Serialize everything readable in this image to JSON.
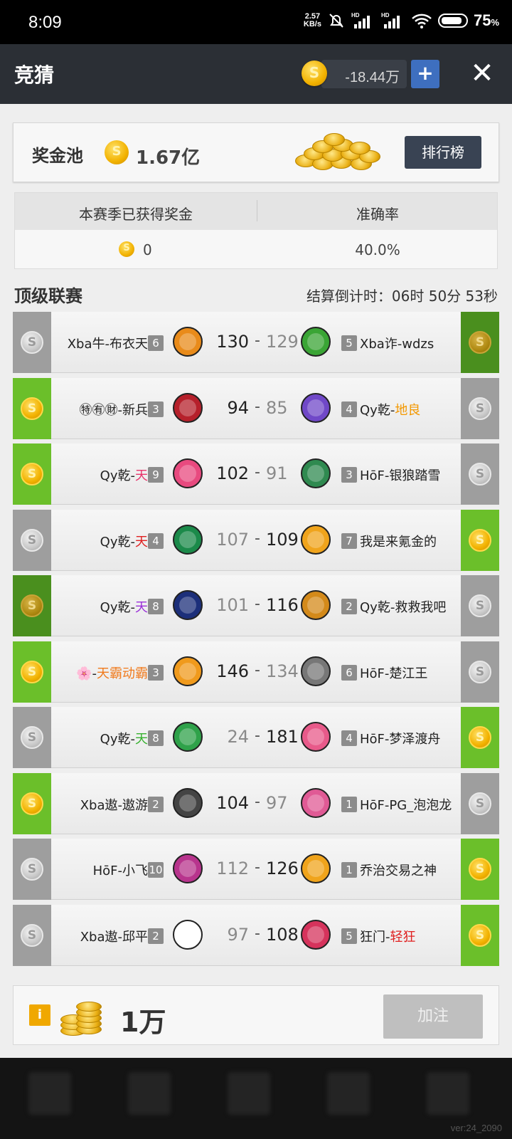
{
  "status_bar": {
    "time": "8:09",
    "net_speed_value": "2.57",
    "net_speed_unit": "KB/s",
    "battery": "75",
    "battery_unit": "%"
  },
  "header": {
    "title": "竞猜",
    "balance": "-18.44万",
    "add_label": "+",
    "close_label": "✕"
  },
  "jackpot": {
    "label": "奖金池",
    "amount": "1.67亿",
    "ranking_button": "排行榜"
  },
  "stats": {
    "earned_label": "本赛季已获得奖金",
    "accuracy_label": "准确率",
    "earned_value": "0",
    "accuracy_value": "40.0%"
  },
  "league": {
    "title": "顶级联赛",
    "countdown": "结算倒计时：06时 50分 53秒"
  },
  "matches": [
    {
      "left_name": "Xba牛-布衣天子",
      "left_suffix": "",
      "left_level": "6",
      "left_score": "130",
      "right_score": "129",
      "right_name": "Xba诈-wdzs",
      "right_suffix": "",
      "right_level": "5",
      "pick": "right",
      "win_side": "left"
    },
    {
      "left_name": "㊕㊒㊖-新兵器",
      "left_suffix": "",
      "left_level": "3",
      "left_score": "94",
      "right_score": "85",
      "right_name": "Qy乾-",
      "right_suffix": "地良",
      "right_level": "4",
      "pick": "left",
      "win_side": "left"
    },
    {
      "left_name": "Qy乾-",
      "left_suffix": "天损",
      "left_level": "9",
      "left_score": "102",
      "right_score": "91",
      "right_name": "HōF-银狼踏雪",
      "right_suffix": "",
      "right_level": "3",
      "pick": "left",
      "win_side": "left"
    },
    {
      "left_name": "Qy乾-",
      "left_suffix": "天逗",
      "left_level": "4",
      "left_score": "107",
      "right_score": "109",
      "right_name": "我是来氪金的",
      "right_suffix": "",
      "right_level": "7",
      "pick": "right",
      "win_side": "right"
    },
    {
      "left_name": "Qy乾-",
      "left_suffix": "天魁",
      "left_level": "8",
      "left_score": "101",
      "right_score": "116",
      "right_name": "Qy乾-救救我吧",
      "right_suffix": "",
      "right_level": "2",
      "pick": "left",
      "win_side": "right"
    },
    {
      "left_name": "🌸-",
      "left_suffix": "天霸动霸哒",
      "left_level": "3",
      "left_score": "146",
      "right_score": "134",
      "right_name": "HōF-楚江王",
      "right_suffix": "",
      "right_level": "6",
      "pick": "left",
      "win_side": "left"
    },
    {
      "left_name": "Qy乾-",
      "left_suffix": "天熊",
      "left_level": "8",
      "left_score": "24",
      "right_score": "181",
      "right_name": "HōF-梦泽渡舟",
      "right_suffix": "",
      "right_level": "4",
      "pick": "right",
      "win_side": "right"
    },
    {
      "left_name": "Xba遨-遨游武",
      "left_suffix": "",
      "left_level": "2",
      "left_score": "104",
      "right_score": "97",
      "right_name": "HōF-PG_泡泡龙",
      "right_suffix": "",
      "right_level": "1",
      "pick": "left",
      "win_side": "left"
    },
    {
      "left_name": "HōF-小飞侠",
      "left_suffix": "",
      "left_level": "10",
      "left_score": "112",
      "right_score": "126",
      "right_name": "乔治交易之神",
      "right_suffix": "",
      "right_level": "1",
      "pick": "right",
      "win_side": "right"
    },
    {
      "left_name": "Xba遨-邱平安",
      "left_suffix": "",
      "left_level": "2",
      "left_score": "97",
      "right_score": "108",
      "right_name": "狂门-",
      "right_suffix": "轻狂",
      "right_level": "5",
      "pick": "right",
      "win_side": "right"
    }
  ],
  "bet": {
    "info_label": "i",
    "amount": "1万",
    "button": "加注"
  },
  "footer": {
    "version": "ver:24_2090"
  },
  "colors": {
    "suffix_colors": [
      "",
      "#f39800",
      "#e8336b",
      "#e02020",
      "#9b30d9",
      "#f07a1c",
      "#36b12e",
      "",
      "",
      "#e02020"
    ],
    "logo_colors": [
      [
        "#e98b1a",
        "#3aa535"
      ],
      [
        "#b6202b",
        "#7048c8"
      ],
      [
        "#e84a7f",
        "#2f8a50"
      ],
      [
        "#1b8a4a",
        "#f0a41c"
      ],
      [
        "#1c2f7a",
        "#d48a1a"
      ],
      [
        "#f09a1c",
        "#777777"
      ],
      [
        "#2fa24a",
        "#e85a8a"
      ],
      [
        "#444444",
        "#e05a95"
      ],
      [
        "#b8348d",
        "#f0a41c"
      ],
      [
        "#ffffff",
        "#d6335c"
      ]
    ]
  }
}
